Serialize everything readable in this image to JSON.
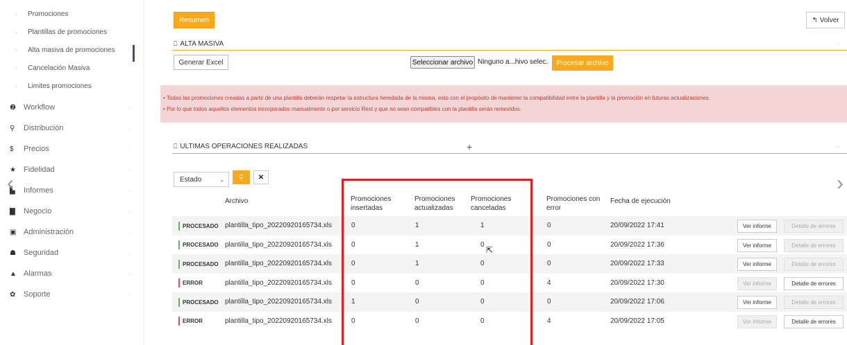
{
  "sidebar": {
    "sub_items": [
      {
        "label": "Promociones"
      },
      {
        "label": "Plantillas de promociones"
      },
      {
        "label": "Alta masiva de promociones"
      },
      {
        "label": "Cancelación Masiva"
      },
      {
        "label": "Limites promociones"
      }
    ],
    "main_items": [
      {
        "label": "Workflow",
        "icon": "question-circle-icon",
        "glyph": "❷"
      },
      {
        "label": "Distribución",
        "icon": "map-marker-icon",
        "glyph": "⚲"
      },
      {
        "label": "Precios",
        "icon": "dollar-icon",
        "glyph": "$"
      },
      {
        "label": "Fidelidad",
        "icon": "star-icon",
        "glyph": "★"
      },
      {
        "label": "Informes",
        "icon": "bar-chart-icon",
        "glyph": "▙"
      },
      {
        "label": "Negocio",
        "icon": "book-icon",
        "glyph": "▇"
      },
      {
        "label": "Administración",
        "icon": "calendar-icon",
        "glyph": "▣"
      },
      {
        "label": "Seguridad",
        "icon": "users-icon",
        "glyph": "☗"
      },
      {
        "label": "Alarmas",
        "icon": "bell-icon",
        "glyph": "▲"
      },
      {
        "label": "Soporte",
        "icon": "gear-icon",
        "glyph": "✿"
      }
    ]
  },
  "header": {
    "resumen_label": "Resumen",
    "volver_label": "Volver"
  },
  "alta_masiva": {
    "title": "ALTA MASIVA",
    "generar_excel_label": "Generar Excel",
    "select_file_label": "Seleccionar archivo",
    "file_name": "Ninguno a...hivo selec.",
    "procesar_label": "Procesar archivo"
  },
  "alert": {
    "lines": [
      "• Todas las promociones creadas a partir de una plantilla deberán respetar la estructura heredada de la misma, esto con el propósito de mantener la compatibilidad entre la plantilla y la promoción en futuras actualizaciones.",
      "• Por lo que todos aquellos elementos incorporados manualmente o por servicio Rest y que no sean compatibles con la plantilla serán removidos."
    ]
  },
  "operaciones": {
    "title": "ULTIMAS OPERACIONES REALIZADAS",
    "filter_value": "Estado",
    "headers": {
      "archivo": "Archivo",
      "insertadas": "Promociones insertadas",
      "actualizadas": "Promociones actualizadas",
      "canceladas": "Promociones canceladas",
      "error": "Promociones con error",
      "fecha": "Fecha de ejecución"
    },
    "rows": [
      {
        "status": "PROCESADO",
        "status_color": "#5cb85c",
        "archivo": "plantilla_tipo_20220920165734.xls",
        "insertadas": "0",
        "actualizadas": "1",
        "canceladas": "1",
        "error": "0",
        "fecha": "20/09/2022 17:41",
        "ver_informe": "Ver informe",
        "detalle": "Detalle de errores",
        "ver_enabled": true,
        "detalle_enabled": false
      },
      {
        "status": "PROCESADO",
        "status_color": "#5cb85c",
        "archivo": "plantilla_tipo_20220920165734.xls",
        "insertadas": "0",
        "actualizadas": "1",
        "canceladas": "0",
        "error": "0",
        "fecha": "20/09/2022 17:36",
        "ver_informe": "Ver informe",
        "detalle": "Detalle de errores",
        "ver_enabled": true,
        "detalle_enabled": false
      },
      {
        "status": "PROCESADO",
        "status_color": "#5cb85c",
        "archivo": "plantilla_tipo_20220920165734.xls",
        "insertadas": "0",
        "actualizadas": "1",
        "canceladas": "0",
        "error": "0",
        "fecha": "20/09/2022 17:33",
        "ver_informe": "Ver informe",
        "detalle": "Detalle de errores",
        "ver_enabled": true,
        "detalle_enabled": false
      },
      {
        "status": "ERROR",
        "status_color": "#d9534f",
        "archivo": "plantilla_tipo_20220920165734.xls",
        "insertadas": "0",
        "actualizadas": "0",
        "canceladas": "0",
        "error": "4",
        "fecha": "20/09/2022 17:30",
        "ver_informe": "Ver informe",
        "detalle": "Detalle de errores",
        "ver_enabled": false,
        "detalle_enabled": true
      },
      {
        "status": "PROCESADO",
        "status_color": "#5cb85c",
        "archivo": "plantilla_tipo_20220920165734.xls",
        "insertadas": "1",
        "actualizadas": "0",
        "canceladas": "0",
        "error": "0",
        "fecha": "20/09/2022 17:06",
        "ver_informe": "Ver informe",
        "detalle": "Detalle de errores",
        "ver_enabled": true,
        "detalle_enabled": false
      },
      {
        "status": "ERROR",
        "status_color": "#d9534f",
        "archivo": "plantilla_tipo_20220920165734.xls",
        "insertadas": "0",
        "actualizadas": "0",
        "canceladas": "0",
        "error": "4",
        "fecha": "20/09/2022 17:05",
        "ver_informe": "Ver informe",
        "detalle": "Detalle de errores",
        "ver_enabled": false,
        "detalle_enabled": true
      }
    ]
  },
  "colors": {
    "accent": "#f9a91b",
    "alert_bg": "#f4d6d6",
    "alert_text": "#c0392b",
    "highlight": "#e02020"
  }
}
